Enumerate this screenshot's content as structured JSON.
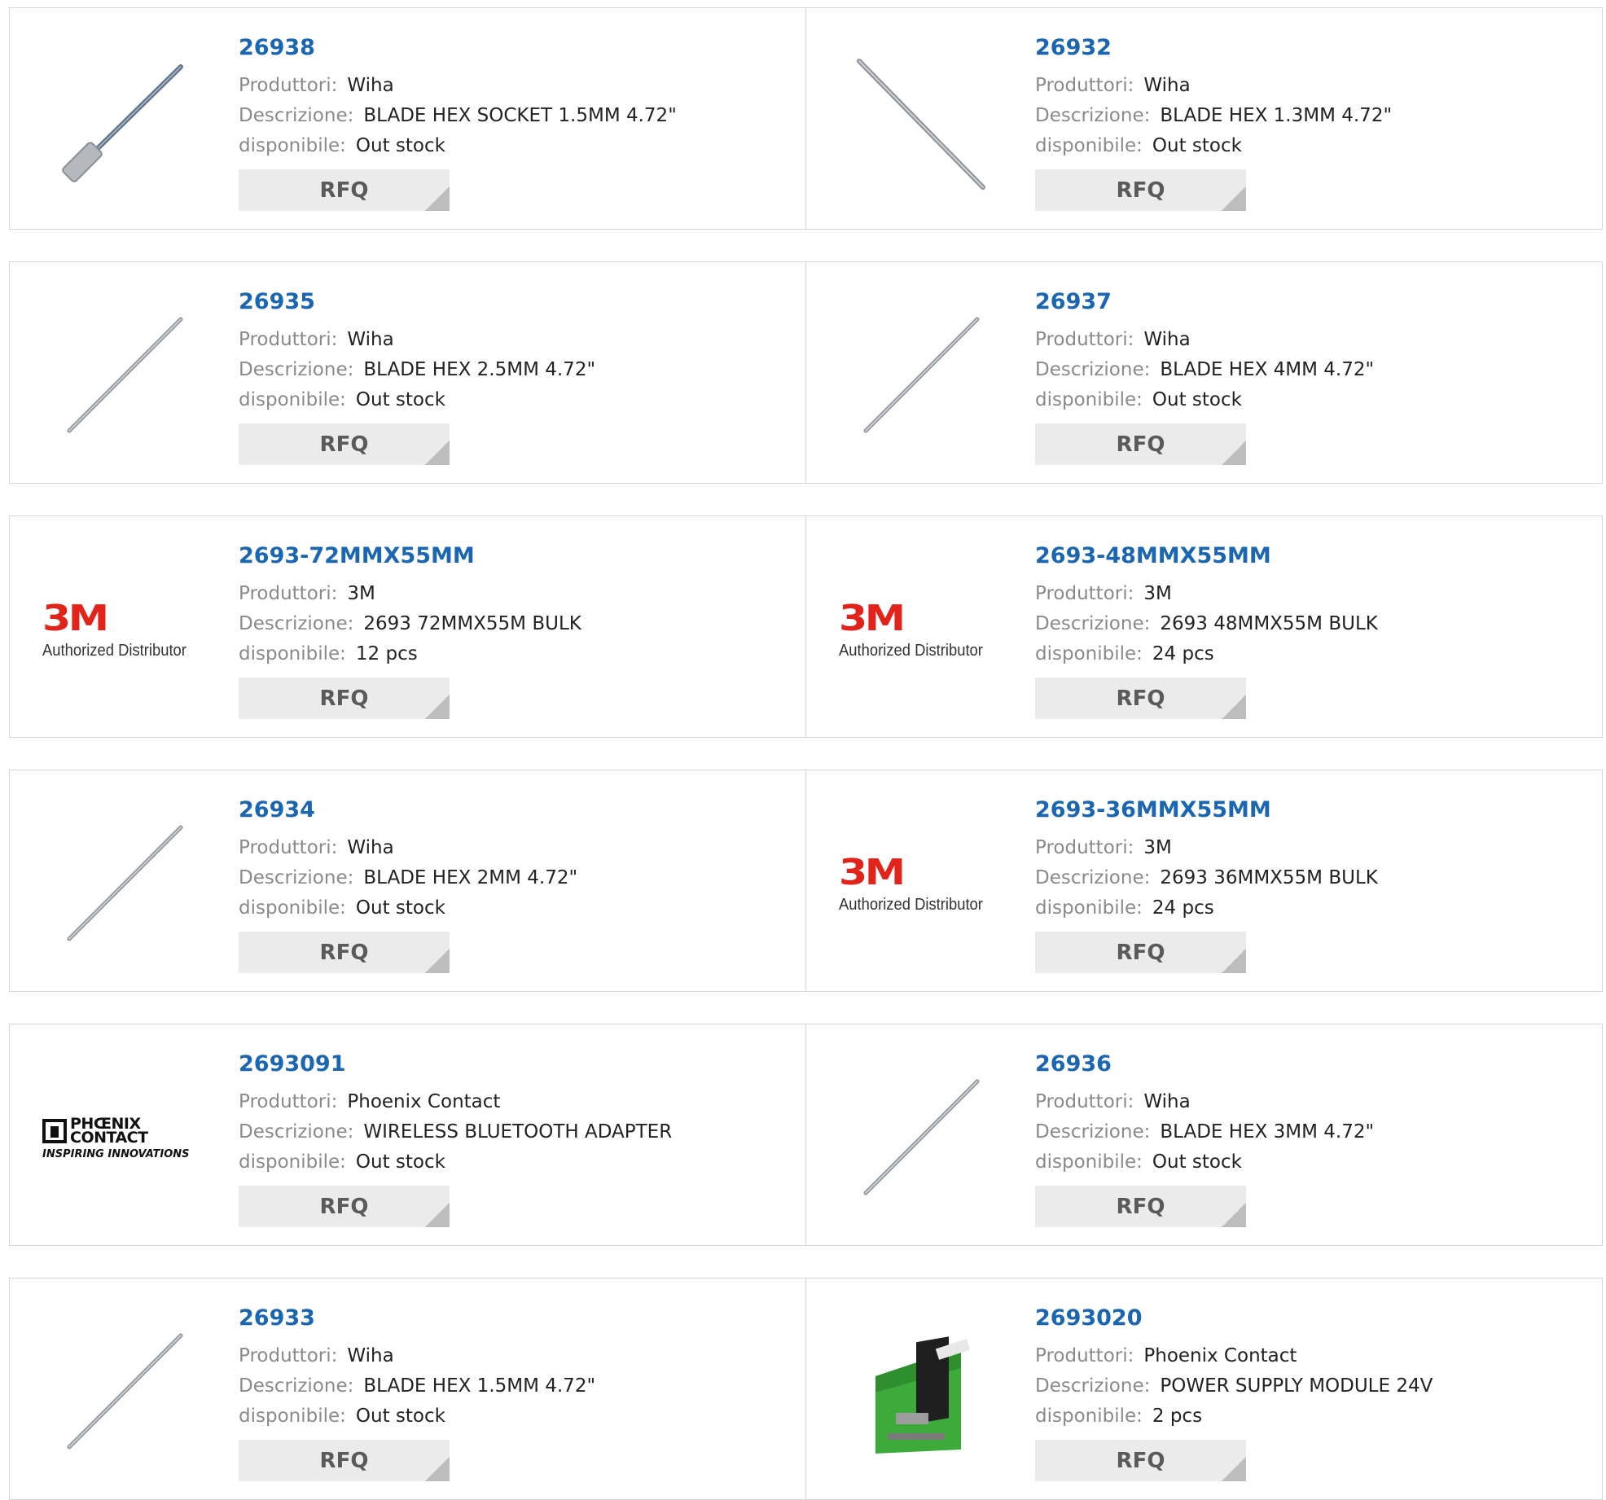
{
  "labels": {
    "manufacturer": "Produttori:",
    "description": "Descrizione:",
    "availability": "disponibile:",
    "rfq": "RFQ"
  },
  "logos": {
    "threem_mark": "3M",
    "threem_tag": "Authorized Distributor",
    "phoenix_name_1": "PHŒNIX",
    "phoenix_name_2": "CONTACT",
    "phoenix_slogan": "INSPIRING INNOVATIONS"
  },
  "colors": {
    "part_link": "#1a66b3",
    "label_gray": "#8a8a8a",
    "rfq_bg": "#ebebeb",
    "threem_red": "#e2231a",
    "module_green": "#3dab3a"
  },
  "products": [
    {
      "part": "26938",
      "manufacturer": "Wiha",
      "description": "BLADE HEX SOCKET 1.5MM 4.72\"",
      "availability": "Out stock",
      "image": "hex-socket-blade"
    },
    {
      "part": "26932",
      "manufacturer": "Wiha",
      "description": "BLADE HEX 1.3MM 4.72\"",
      "availability": "Out stock",
      "image": "hex-blade-steep"
    },
    {
      "part": "26935",
      "manufacturer": "Wiha",
      "description": "BLADE HEX 2.5MM 4.72\"",
      "availability": "Out stock",
      "image": "hex-blade"
    },
    {
      "part": "26937",
      "manufacturer": "Wiha",
      "description": "BLADE HEX 4MM 4.72\"",
      "availability": "Out stock",
      "image": "hex-blade"
    },
    {
      "part": "2693-72MMX55MM",
      "manufacturer": "3M",
      "description": "2693 72MMX55M BULK",
      "availability": "12 pcs",
      "image": "3m-logo"
    },
    {
      "part": "2693-48MMX55MM",
      "manufacturer": "3M",
      "description": "2693 48MMX55M BULK",
      "availability": "24 pcs",
      "image": "3m-logo"
    },
    {
      "part": "26934",
      "manufacturer": "Wiha",
      "description": "BLADE HEX 2MM 4.72\"",
      "availability": "Out stock",
      "image": "hex-blade"
    },
    {
      "part": "2693-36MMX55MM",
      "manufacturer": "3M",
      "description": "2693 36MMX55M BULK",
      "availability": "24 pcs",
      "image": "3m-logo"
    },
    {
      "part": "2693091",
      "manufacturer": "Phoenix Contact",
      "description": "WIRELESS BLUETOOTH ADAPTER",
      "availability": "Out stock",
      "image": "phoenix-logo"
    },
    {
      "part": "26936",
      "manufacturer": "Wiha",
      "description": "BLADE HEX 3MM 4.72\"",
      "availability": "Out stock",
      "image": "hex-blade"
    },
    {
      "part": "26933",
      "manufacturer": "Wiha",
      "description": "BLADE HEX 1.5MM 4.72\"",
      "availability": "Out stock",
      "image": "hex-blade"
    },
    {
      "part": "2693020",
      "manufacturer": "Phoenix Contact",
      "description": "POWER SUPPLY MODULE 24V",
      "availability": "2 pcs",
      "image": "power-module"
    }
  ]
}
